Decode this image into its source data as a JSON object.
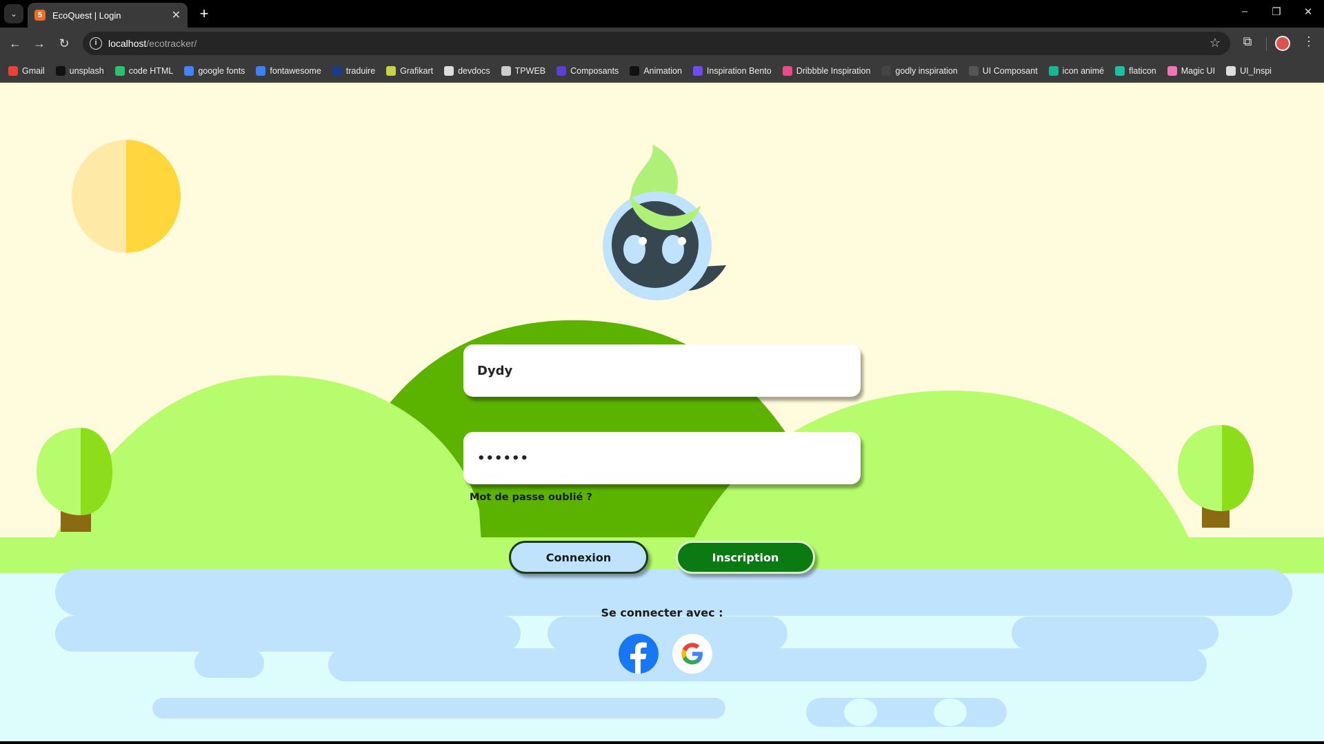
{
  "browser": {
    "tab_title": "EcoQuest | Login",
    "url_host": "localhost",
    "url_path": "/ecotracker/",
    "bookmarks": [
      {
        "label": "Gmail",
        "icon": "gmail-icon",
        "color": "#ea4335"
      },
      {
        "label": "unsplash",
        "icon": "unsplash-icon",
        "color": "#111111"
      },
      {
        "label": "code HTML",
        "icon": "code-html-icon",
        "color": "#2fbf71"
      },
      {
        "label": "google fonts",
        "icon": "google-fonts-icon",
        "color": "#4285f4"
      },
      {
        "label": "fontawesome",
        "icon": "fontawesome-icon",
        "color": "#3b82f6"
      },
      {
        "label": "traduire",
        "icon": "traduire-icon",
        "color": "#1e3a8a"
      },
      {
        "label": "Grafikart",
        "icon": "grafikart-icon",
        "color": "#c7d14c"
      },
      {
        "label": "devdocs",
        "icon": "devdocs-icon",
        "color": "#dddddd"
      },
      {
        "label": "TPWEB",
        "icon": "tpweb-icon",
        "color": "#cccccc"
      },
      {
        "label": "Composants",
        "icon": "composants-icon",
        "color": "#5b3fd1"
      },
      {
        "label": "Animation",
        "icon": "animation-icon",
        "color": "#111111"
      },
      {
        "label": "Inspiration Bento",
        "icon": "bento-icon",
        "color": "#6d4cf0"
      },
      {
        "label": "Dribbble Inspiration",
        "icon": "dribbble-icon",
        "color": "#ea4c89"
      },
      {
        "label": "godly inspiration",
        "icon": "godly-icon",
        "color": "#444444"
      },
      {
        "label": "UI Composant",
        "icon": "ui-composant-icon",
        "color": "#555555"
      },
      {
        "label": "icon animé",
        "icon": "icon-anime-icon",
        "color": "#17b890"
      },
      {
        "label": "flaticon",
        "icon": "flaticon-icon",
        "color": "#1cbf9f"
      },
      {
        "label": "Magic UI",
        "icon": "magic-ui-icon",
        "color": "#f472b6"
      },
      {
        "label": "UI_Inspi",
        "icon": "ui-inspi-icon",
        "color": "#dddddd"
      }
    ]
  },
  "login": {
    "username_value": "Dydy",
    "password_value": "••••••",
    "forgot_password": "Mot de passe oublié ?",
    "login_button": "Connexion",
    "signup_button": "Inscription",
    "social_label": "Se connecter avec :",
    "social_providers": [
      "facebook-icon",
      "google-icon"
    ]
  },
  "colors": {
    "page_background": "#fffbdc",
    "hill_dark": "#5bb300",
    "hill_light": "#b6fc6c",
    "water": "#bfe2fd",
    "signup_button": "#0c7a12",
    "login_button": "#bfe2fd"
  }
}
